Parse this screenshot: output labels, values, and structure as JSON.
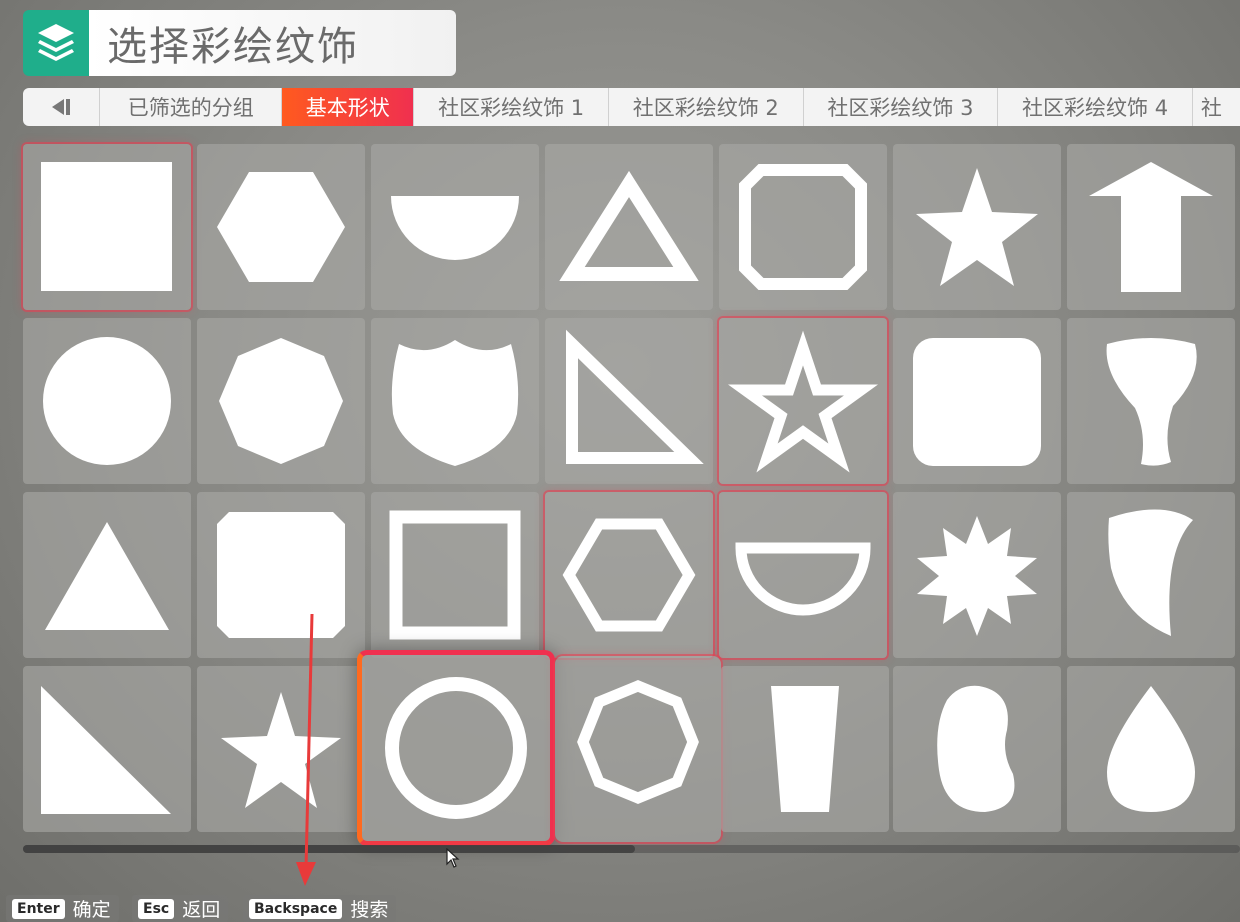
{
  "header": {
    "title": "选择彩绘纹饰",
    "icon": "layers-icon",
    "icon_color": "#1fae8b"
  },
  "tabs": {
    "prev_icon": "prev-tab-icon",
    "items": [
      {
        "label": "已筛选的分组",
        "active": false
      },
      {
        "label": "基本形状",
        "active": true
      },
      {
        "label": "社区彩绘纹饰 1",
        "active": false
      },
      {
        "label": "社区彩绘纹饰 2",
        "active": false
      },
      {
        "label": "社区彩绘纹饰 3",
        "active": false
      },
      {
        "label": "社区彩绘纹饰 4",
        "active": false
      },
      {
        "label": "社",
        "active": false
      }
    ],
    "active_color_start": "#ff5a1f",
    "active_color_end": "#f0304f"
  },
  "shapes": [
    [
      "square",
      "hexagon",
      "half-circle",
      "triangle-outline",
      "octagon-outline",
      "star",
      "arrow-up"
    ],
    [
      "circle",
      "octagon",
      "shield",
      "right-triangle-outline",
      "star-outline",
      "rounded-square",
      "tapered-curve"
    ],
    [
      "triangle",
      "cut-corner-square",
      "square-outline",
      "hexagon-outline",
      "half-circle-outline",
      "starburst",
      "claw"
    ],
    [
      "right-triangle",
      "star",
      "circle-outline",
      "octagon-outline",
      "trapezoid",
      "bean",
      "drop"
    ]
  ],
  "selected": {
    "row": 3,
    "col": 2,
    "name": "circle-outline"
  },
  "footer": {
    "hints": [
      {
        "key": "Enter",
        "label": "确定"
      },
      {
        "key": "Esc",
        "label": "返回"
      },
      {
        "key": "Backspace",
        "label": "搜索"
      }
    ]
  },
  "colors": {
    "selection_border": "#f0304f",
    "selection_border_start": "#ff6a1f",
    "shape_fill": "#ffffff",
    "annotation_arrow": "#e83a3a"
  }
}
